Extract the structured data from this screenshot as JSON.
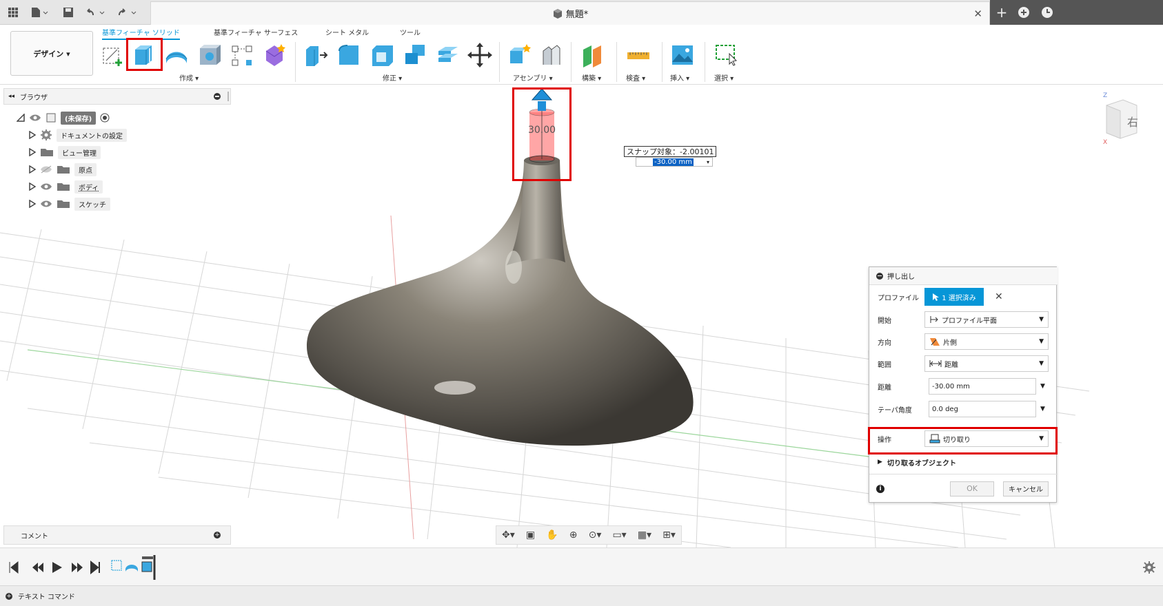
{
  "window": {
    "doc_title": "無題*"
  },
  "toolbar": {
    "design_label": "デザイン ▾",
    "tabs": [
      "基準フィーチャ ソリッド",
      "基準フィーチャ サーフェス",
      "シート メタル",
      "ツール"
    ],
    "groups": [
      "作成 ▾",
      "修正 ▾",
      "アセンブリ ▾",
      "構築 ▾",
      "検査 ▾",
      "挿入 ▾",
      "選択 ▾"
    ]
  },
  "browser": {
    "title": "ブラウザ",
    "root": "(未保存)",
    "items": [
      "ドキュメントの設定",
      "ビュー管理",
      "原点",
      "ボディ",
      "スケッチ"
    ]
  },
  "viewport": {
    "dimension_label": "30.00",
    "snap_label": "スナップ対象：-2.00101",
    "input_value": "-30.00 mm",
    "viewcube_face": "右"
  },
  "panel": {
    "title": "押し出し",
    "rows": {
      "profile_label": "プロファイル",
      "profile_value": "1 選択済み",
      "start_label": "開始",
      "start_value": "プロファイル平面",
      "direction_label": "方向",
      "direction_value": "片側",
      "extent_label": "範囲",
      "extent_value": "距離",
      "distance_label": "距離",
      "distance_value": "-30.00 mm",
      "taper_label": "テーパ角度",
      "taper_value": "0.0 deg",
      "operation_label": "操作",
      "operation_value": "切り取り",
      "objects_label": "切り取るオブジェクト"
    },
    "ok": "OK",
    "cancel": "キャンセル"
  },
  "comments": {
    "label": "コメント"
  },
  "textcmd": {
    "label": "テキスト コマンド"
  },
  "colors": {
    "accent": "#0696d7",
    "highlight": "#e00000"
  }
}
